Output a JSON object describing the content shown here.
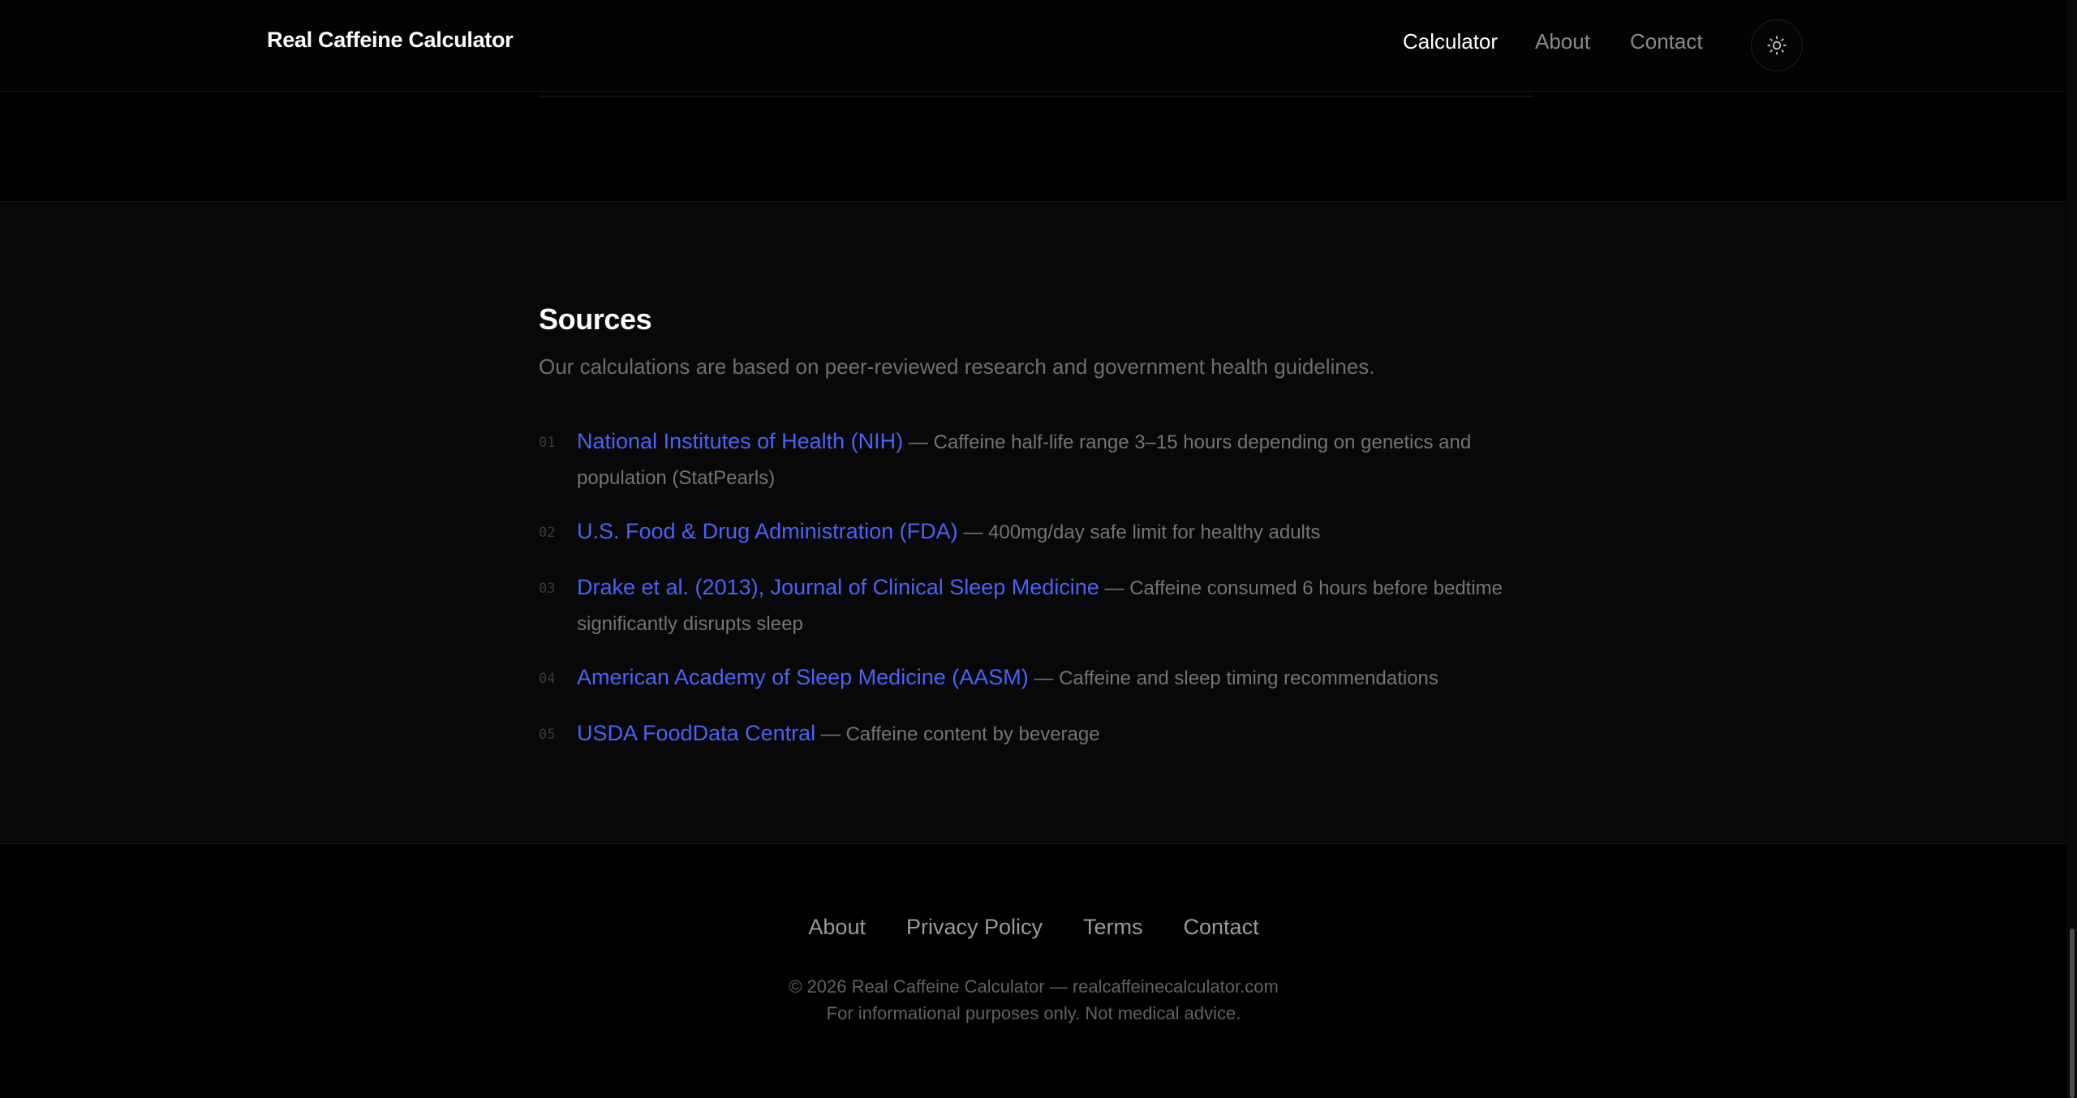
{
  "header": {
    "brand": "Real Caffeine Calculator",
    "nav": [
      {
        "label": "Calculator",
        "active": true
      },
      {
        "label": "About",
        "active": false
      },
      {
        "label": "Contact",
        "active": false
      }
    ],
    "theme_toggle_icon": "sun-icon"
  },
  "sources": {
    "title": "Sources",
    "subtitle": "Our calculations are based on peer-reviewed research and government health guidelines.",
    "items": [
      {
        "num": "01",
        "link": "National Institutes of Health (NIH)",
        "desc": " — Caffeine half-life range 3–15 hours depending on genetics and population (StatPearls)"
      },
      {
        "num": "02",
        "link": "U.S. Food & Drug Administration (FDA)",
        "desc": " — 400mg/day safe limit for healthy adults"
      },
      {
        "num": "03",
        "link": "Drake et al. (2013), Journal of Clinical Sleep Medicine",
        "desc": " — Caffeine consumed 6 hours before bedtime significantly disrupts sleep"
      },
      {
        "num": "04",
        "link": "American Academy of Sleep Medicine (AASM)",
        "desc": " — Caffeine and sleep timing recommendations"
      },
      {
        "num": "05",
        "link": "USDA FoodData Central",
        "desc": " — Caffeine content by beverage"
      }
    ]
  },
  "footer": {
    "links": [
      "About",
      "Privacy Policy",
      "Terms",
      "Contact"
    ],
    "copyright": "© 2026 Real Caffeine Calculator — realcaffeinecalculator.com",
    "disclaimer": "For informational purposes only. Not medical advice."
  },
  "colors": {
    "background": "#000000",
    "link": "#4a62f5",
    "muted_text": "#747474"
  }
}
